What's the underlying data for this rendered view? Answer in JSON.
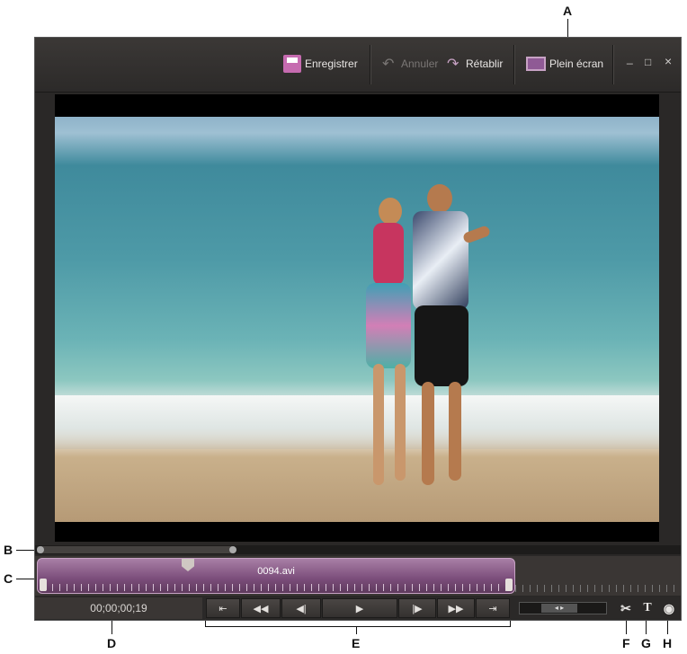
{
  "callouts": {
    "A": "A",
    "B": "B",
    "C": "C",
    "D": "D",
    "E": "E",
    "F": "F",
    "G": "G",
    "H": "H"
  },
  "toolbar": {
    "save_label": "Enregistrer",
    "undo_label": "Annuler",
    "redo_label": "Rétablir",
    "fullscreen_label": "Plein écran",
    "minimize_glyph": "_",
    "maximize_glyph": "□",
    "close_glyph": "×"
  },
  "timeline": {
    "clip_name": "0094.avi"
  },
  "transport": {
    "timecode": "00;00;00;19",
    "buttons": [
      "⇤",
      "◀◀",
      "◀|",
      "▶",
      "|▶",
      "▶▶",
      "⇥"
    ]
  },
  "tools": {
    "split_glyph": "✂",
    "text_glyph": "T",
    "snapshot_glyph": "◉"
  },
  "colors": {
    "accent_clip": "#7a4c79",
    "app_bg": "#2a2827"
  }
}
